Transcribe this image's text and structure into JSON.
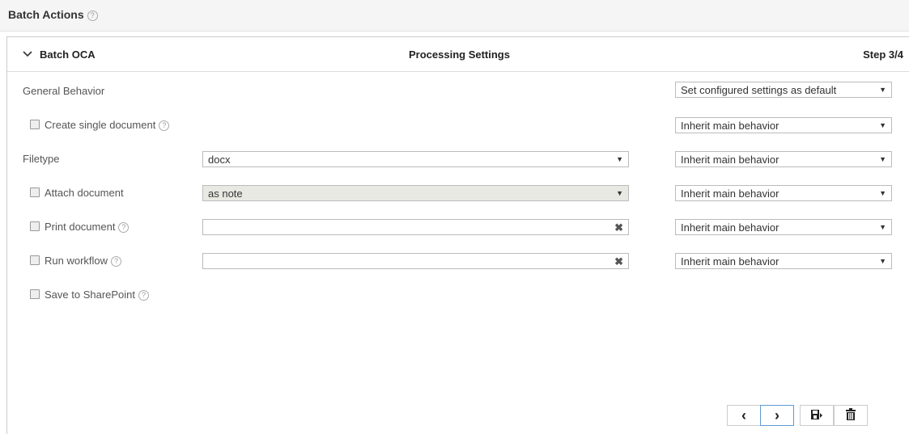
{
  "header": {
    "title": "Batch Actions",
    "help_icon": "question-circle-icon"
  },
  "panel": {
    "title": "Batch OCA",
    "center_title": "Processing Settings",
    "step": "Step 3/4"
  },
  "rows": {
    "general": {
      "label": "General Behavior",
      "behavior": "Set configured settings as default"
    },
    "single_doc": {
      "label": "Create single document",
      "behavior": "Inherit main behavior"
    },
    "filetype": {
      "label": "Filetype",
      "value": "docx",
      "behavior": "Inherit main behavior"
    },
    "attach": {
      "label": "Attach document",
      "value": "as note",
      "behavior": "Inherit main behavior"
    },
    "print": {
      "label": "Print document",
      "value": "",
      "behavior": "Inherit main behavior"
    },
    "workflow": {
      "label": "Run workflow",
      "value": "",
      "behavior": "Inherit main behavior"
    },
    "sharepoint": {
      "label": "Save to SharePoint"
    }
  },
  "footer": {
    "prev": "‹",
    "next": "›",
    "save_icon": "save-next-icon",
    "delete_icon": "trash-icon"
  },
  "glyphs": {
    "help": "?",
    "arrow": "▼",
    "clear": "✖"
  }
}
